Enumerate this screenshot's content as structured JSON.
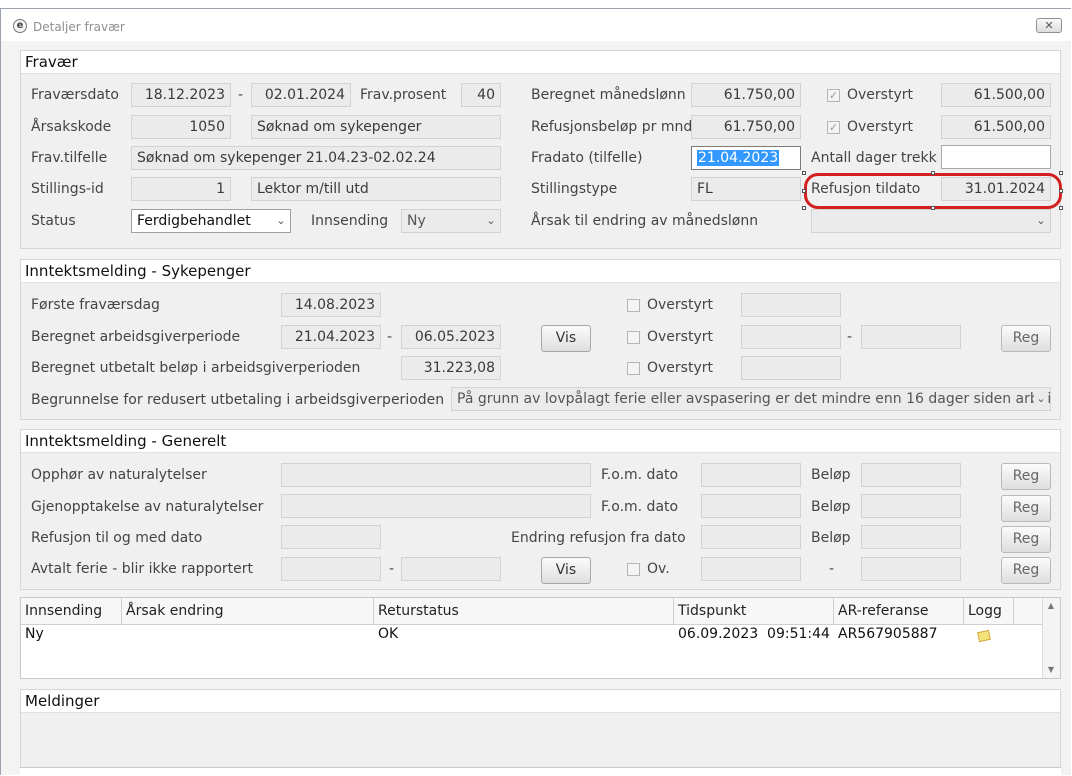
{
  "window": {
    "title": "Detaljer fravær",
    "close_label": "✕"
  },
  "fravaer": {
    "title": "Fravær",
    "fravaersdato_label": "Fraværsdato",
    "fravaersdato_fra": "18.12.2023",
    "fravaersdato_sep": "-",
    "fravaersdato_til": "02.01.2024",
    "frav_prosent_label": "Frav.prosent",
    "frav_prosent": "40",
    "arsakskode_label": "Årsakskode",
    "arsakskode": "1050",
    "arsakskode_tekst": "Søknad om sykepenger",
    "frav_tilfelle_label": "Frav.tilfelle",
    "frav_tilfelle": "Søknad om sykepenger 21.04.23-02.02.24",
    "stillings_id_label": "Stillings-id",
    "stillings_id": "1",
    "stillings_tekst": "Lektor m/till utd",
    "status_label": "Status",
    "status_value": "Ferdigbehandlet",
    "innsending_label": "Innsending",
    "innsending_value": "Ny",
    "beregnet_maanedslonn_label": "Beregnet månedslønn",
    "beregnet_maanedslonn": "61.750,00",
    "overstyrt_label_1": "Overstyrt",
    "overstyrt_value_1": "61.500,00",
    "refusjonsbelop_label": "Refusjonsbeløp pr mnd",
    "refusjonsbelop": "61.750,00",
    "overstyrt_label_2": "Overstyrt",
    "overstyrt_value_2": "61.500,00",
    "fradato_label": "Fradato (tilfelle)",
    "fradato": "21.04.2023",
    "antall_dager_trekk_label": "Antall dager trekk",
    "antall_dager_trekk": "",
    "stillingstype_label": "Stillingstype",
    "stillingstype": "FL",
    "refusjon_tildato_label": "Refusjon tildato",
    "refusjon_tildato": "31.01.2024",
    "arsak_endring_label": "Årsak til endring av månedslønn",
    "arsak_endring_value": ""
  },
  "sykepenger": {
    "title": "Inntektsmelding - Sykepenger",
    "forste_fravaersdag_label": "Første fraværsdag",
    "forste_fravaersdag": "14.08.2023",
    "beregnet_agp_label": "Beregnet arbeidsgiverperiode",
    "agp_fra": "21.04.2023",
    "agp_sep": "-",
    "agp_til": "06.05.2023",
    "vis_label": "Vis",
    "beregnet_utbetalt_label": "Beregnet utbetalt beløp i arbeidsgiverperioden",
    "beregnet_utbetalt": "31.223,08",
    "overstyrt_label_a": "Overstyrt",
    "overstyrt_label_b": "Overstyrt",
    "overstyrt_label_c": "Overstyrt",
    "overstyrt_sep": "-",
    "reg_label": "Reg",
    "begrunnelse_label": "Begrunnelse for redusert utbetaling i arbeidsgiverperioden",
    "begrunnelse_value": "På grunn av lovpålagt ferie eller avspasering er det mindre enn 16 dager siden arbeidet b"
  },
  "generelt": {
    "title": "Inntektsmelding - Generelt",
    "opphor_label": "Opphør av naturalytelser",
    "gjenopptakelse_label": "Gjenopptakelse av naturalytelser",
    "refusjon_til_label": "Refusjon til og med dato",
    "avtalt_ferie_label": "Avtalt ferie - blir ikke rapportert",
    "fom_dato_label_1": "F.o.m. dato",
    "fom_dato_label_2": "F.o.m. dato",
    "endring_refusjon_label": "Endring refusjon fra dato",
    "belop_label_1": "Beløp",
    "belop_label_2": "Beløp",
    "belop_label_3": "Beløp",
    "ov_label": "Ov.",
    "sep": "-",
    "sep2": "-",
    "vis_label": "Vis",
    "reg_label": "Reg"
  },
  "log_table": {
    "columns": [
      "Innsending",
      "Årsak endring",
      "Returstatus",
      "Tidspunkt",
      "AR-referanse",
      "Logg"
    ],
    "rows": [
      [
        "Ny",
        "",
        "OK",
        "06.09.2023  09:51:44",
        "AR567905887",
        ""
      ]
    ]
  },
  "meldinger": {
    "title": "Meldinger"
  },
  "icons": {
    "app": "app-logo-icon",
    "close": "close-icon",
    "dropdown": "chevron-down-icon",
    "checkbox_checked": "check-icon",
    "logg": "note-icon"
  }
}
